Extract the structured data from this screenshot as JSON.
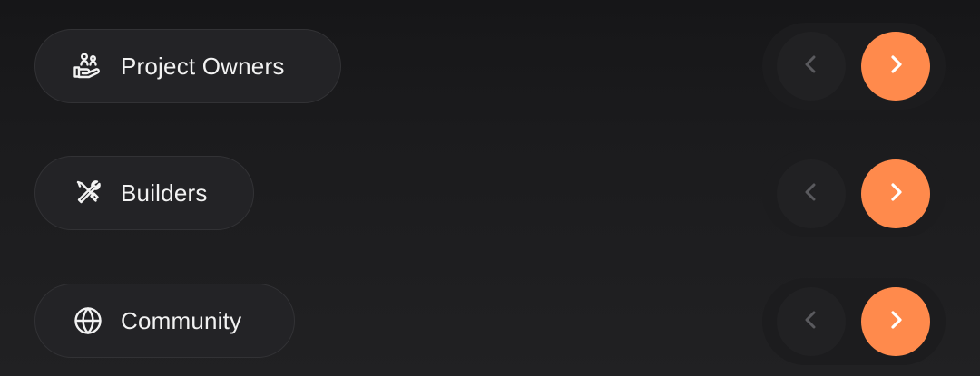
{
  "theme": {
    "accent": "#ff8a4c",
    "prev_arrow_color": "#5a5a5e",
    "next_arrow_color": "#ffffff"
  },
  "rows": [
    {
      "label": "Project Owners",
      "icon": "hand-holding-people-icon"
    },
    {
      "label": "Builders",
      "icon": "tools-icon"
    },
    {
      "label": "Community",
      "icon": "globe-icon"
    }
  ],
  "nav": {
    "prev_icon": "chevron-left-icon",
    "next_icon": "chevron-right-icon"
  }
}
